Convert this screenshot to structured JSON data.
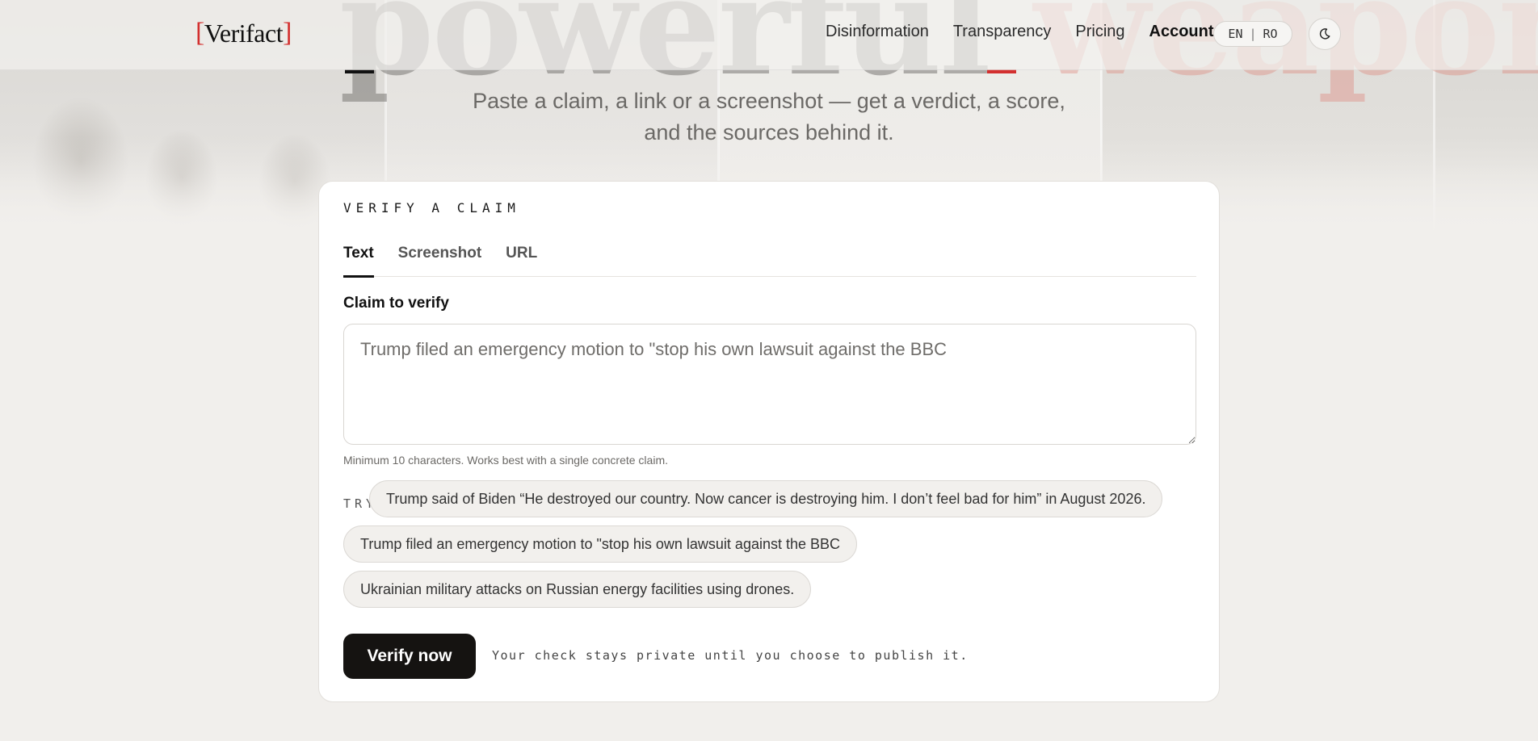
{
  "brand": {
    "name": "Verifact"
  },
  "hero": {
    "headline_words": [
      "powerful",
      "weapon."
    ],
    "subtitle_line1": "Paste a claim, a link or a screenshot — get a verdict, a score,",
    "subtitle_line2": "and the sources behind it."
  },
  "nav": {
    "items": [
      {
        "label": "Disinformation",
        "active": false
      },
      {
        "label": "Transparency",
        "active": false
      },
      {
        "label": "Pricing",
        "active": false
      },
      {
        "label": "Account",
        "active": true
      }
    ],
    "lang": {
      "en": "EN",
      "ro": "RO",
      "separator": "|"
    },
    "theme_icon": "moon-icon"
  },
  "card": {
    "title": "VERIFY A CLAIM",
    "tabs": [
      {
        "label": "Text",
        "active": true
      },
      {
        "label": "Screenshot",
        "active": false
      },
      {
        "label": "URL",
        "active": false
      }
    ],
    "field_label": "Claim to verify",
    "input_placeholder": "Trump filed an emergency motion to \"stop his own lawsuit against the BBC",
    "input_value": "",
    "hint": "Minimum 10 characters. Works best with a single concrete claim.",
    "try_label": "TRY",
    "suggestions": [
      "Trump said of Biden “He destroyed our country. Now cancer is destroying him. I don’t feel bad for him” in August 2026.",
      "Trump filed an emergency motion to \"stop his own lawsuit against the BBC",
      "Ukrainian military attacks on Russian energy facilities using drones."
    ],
    "submit_label": "Verify now",
    "privacy_note": "Your check stays private until you choose to publish it."
  },
  "colors": {
    "accent": "#d3302f",
    "button_bg": "#151311",
    "page_bg": "#f1efec"
  }
}
